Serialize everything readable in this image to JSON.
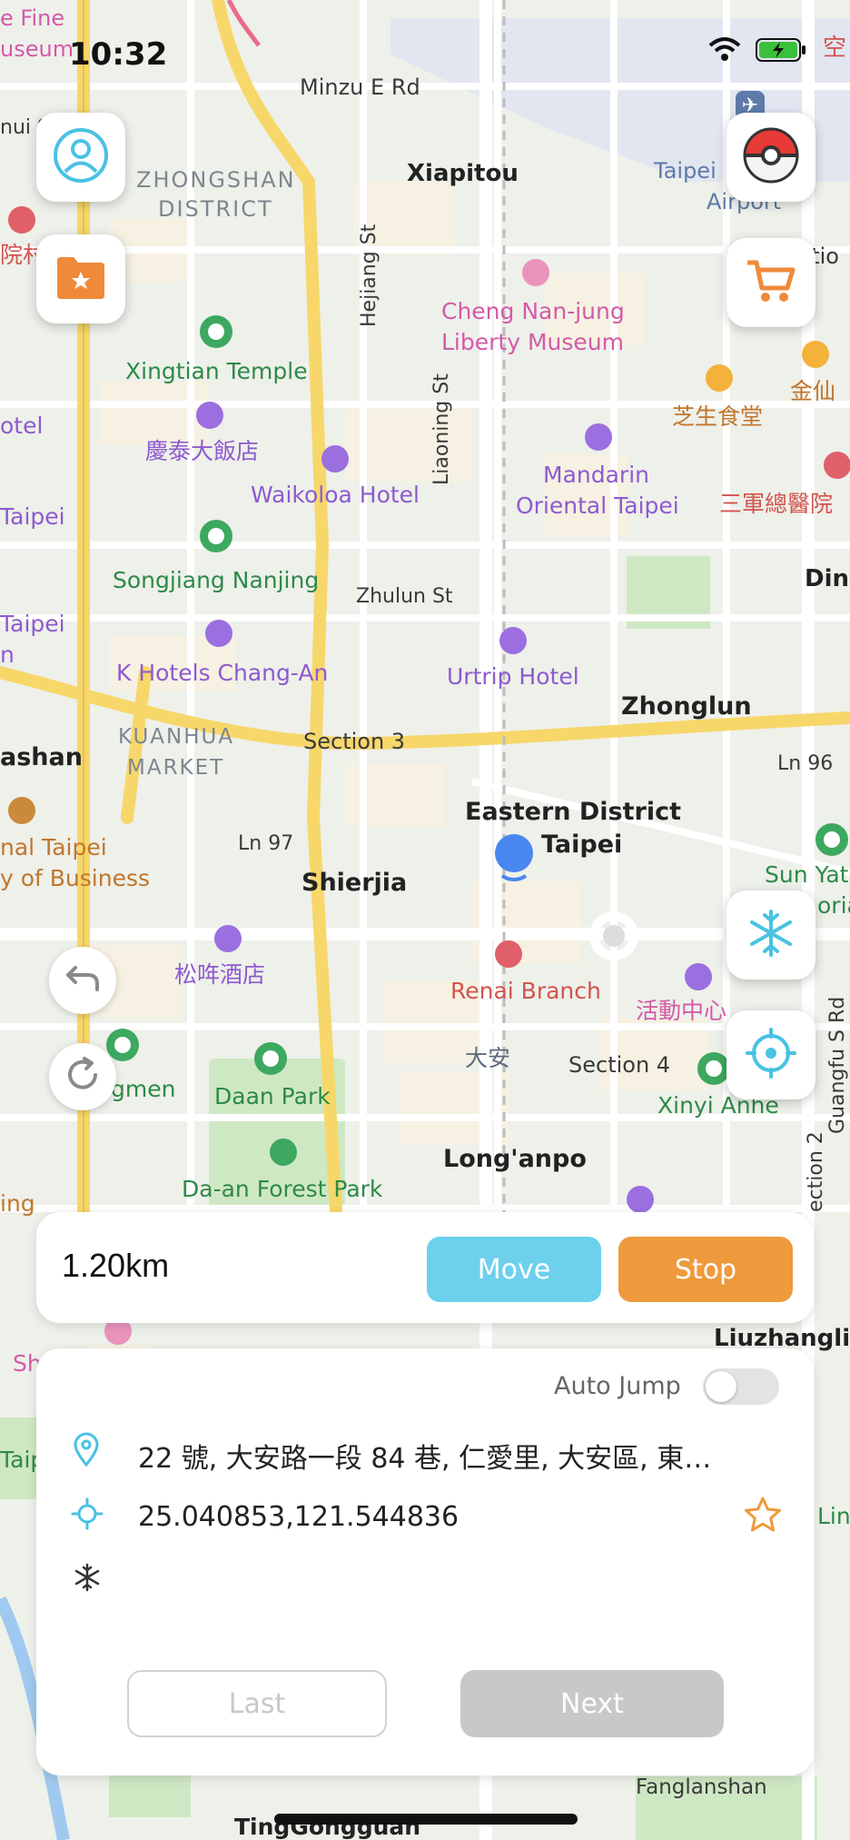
{
  "status": {
    "time": "10:32",
    "carrier_label": "空"
  },
  "map": {
    "labels": [
      {
        "key": "minzu",
        "text": "Minzu E Rd"
      },
      {
        "key": "xiapitou",
        "text": "Xiapitou"
      },
      {
        "key": "zhongshan1",
        "text": "ZHONGSHAN"
      },
      {
        "key": "zhongshan2",
        "text": "DISTRICT"
      },
      {
        "key": "taipei_airport1",
        "text": "Taipei"
      },
      {
        "key": "taipei_airport2",
        "text": "Airport"
      },
      {
        "key": "cheng1",
        "text": "Cheng Nan-jung"
      },
      {
        "key": "cheng2",
        "text": "Liberty Museum"
      },
      {
        "key": "xingtian",
        "text": "Xingtian Temple"
      },
      {
        "key": "hejiang",
        "text": "Hejiang St"
      },
      {
        "key": "liaoning",
        "text": "Liaoning St"
      },
      {
        "key": "qingtai",
        "text": "慶泰大飯店"
      },
      {
        "key": "waikoloa",
        "text": "Waikoloa Hotel"
      },
      {
        "key": "mandarin1",
        "text": "Mandarin"
      },
      {
        "key": "mandarin2",
        "text": "Oriental Taipei"
      },
      {
        "key": "zhisheng",
        "text": "芝生食堂"
      },
      {
        "key": "jinxian",
        "text": "金仙"
      },
      {
        "key": "sanjun",
        "text": "三軍總醫院"
      },
      {
        "key": "songjiang",
        "text": "Songjiang Nanjing"
      },
      {
        "key": "zhulun",
        "text": "Zhulun St"
      },
      {
        "key": "din",
        "text": "Din"
      },
      {
        "key": "khotels",
        "text": "K Hotels Chang-An"
      },
      {
        "key": "urtrip",
        "text": "Urtrip Hotel"
      },
      {
        "key": "zhonglun",
        "text": "Zhonglun"
      },
      {
        "key": "kuanhua1",
        "text": "KUANHUA"
      },
      {
        "key": "kuanhua2",
        "text": "MARKET"
      },
      {
        "key": "section3",
        "text": "Section 3"
      },
      {
        "key": "ln96",
        "text": "Ln 96"
      },
      {
        "key": "shan",
        "text": "ashan"
      },
      {
        "key": "eastern1",
        "text": "Eastern District"
      },
      {
        "key": "eastern2",
        "text": "Taipei"
      },
      {
        "key": "ln97",
        "text": "Ln 97"
      },
      {
        "key": "shierjia",
        "text": "Shierjia"
      },
      {
        "key": "nal_taipei",
        "text": "nal Taipei"
      },
      {
        "key": "of_business",
        "text": "y of Business"
      },
      {
        "key": "sunyat1",
        "text": "Sun Yat"
      },
      {
        "key": "sunyat2",
        "text": "oria"
      },
      {
        "key": "songnian",
        "text": "松哖酒店"
      },
      {
        "key": "renai",
        "text": "Renai Branch"
      },
      {
        "key": "huodong",
        "text": "活動中心"
      },
      {
        "key": "guangfu",
        "text": "Guangfu S Rd"
      },
      {
        "key": "daan_cn",
        "text": "大安"
      },
      {
        "key": "section4",
        "text": "Section 4"
      },
      {
        "key": "gmen",
        "text": "gmen"
      },
      {
        "key": "daanpark",
        "text": "Daan Park"
      },
      {
        "key": "xinyi",
        "text": "Xinyi Anhe"
      },
      {
        "key": "longanpo",
        "text": "Long'anpo"
      },
      {
        "key": "daanforest",
        "text": "Da-an Forest Park"
      },
      {
        "key": "section2",
        "text": "ection 2"
      },
      {
        "key": "liuzhangli",
        "text": "Liuzhangli"
      },
      {
        "key": "fanglanshan",
        "text": "Fanglanshan"
      },
      {
        "key": "tinggongguan",
        "text": "TingGongguan"
      },
      {
        "key": "fine",
        "text": "e Fine"
      },
      {
        "key": "useum",
        "text": "useum"
      },
      {
        "key": "hui",
        "text": "nui S"
      },
      {
        "key": "hospital_l",
        "text": "院村"
      },
      {
        "key": "hotel_l",
        "text": "otel"
      },
      {
        "key": "taipei_l",
        "text": "Taipei"
      },
      {
        "key": "taipei_l2",
        "text": "Taipei"
      },
      {
        "key": "n_l",
        "text": "n"
      },
      {
        "key": "ctio",
        "text": "ctio"
      },
      {
        "key": "ing",
        "text": "ing"
      },
      {
        "key": "sh",
        "text": "Sh"
      },
      {
        "key": "taip_l",
        "text": "Taip"
      },
      {
        "key": "lin",
        "text": "Lin"
      }
    ]
  },
  "distance": {
    "value": "1.20km",
    "move_label": "Move",
    "stop_label": "Stop"
  },
  "panel": {
    "auto_jump_label": "Auto Jump",
    "auto_jump_on": false,
    "address": "22 號, 大安路一段 84 巷, 仁愛里, 大安區, 東…",
    "coordinates": "25.040853,121.544836",
    "last_label": "Last",
    "next_label": "Next"
  },
  "colors": {
    "accent_blue": "#6dd0ed",
    "accent_orange": "#ef9a3c",
    "location_dot": "#4a86f0"
  },
  "icons": [
    "profile-icon",
    "favorites-folder-icon",
    "pokeball-icon",
    "cart-icon",
    "snowflake-icon",
    "crosshair-icon",
    "undo-icon",
    "refresh-icon",
    "location-pin-icon",
    "coordinate-icon",
    "star-icon",
    "wifi-icon",
    "battery-icon",
    "signal-icon",
    "airport-icon"
  ]
}
